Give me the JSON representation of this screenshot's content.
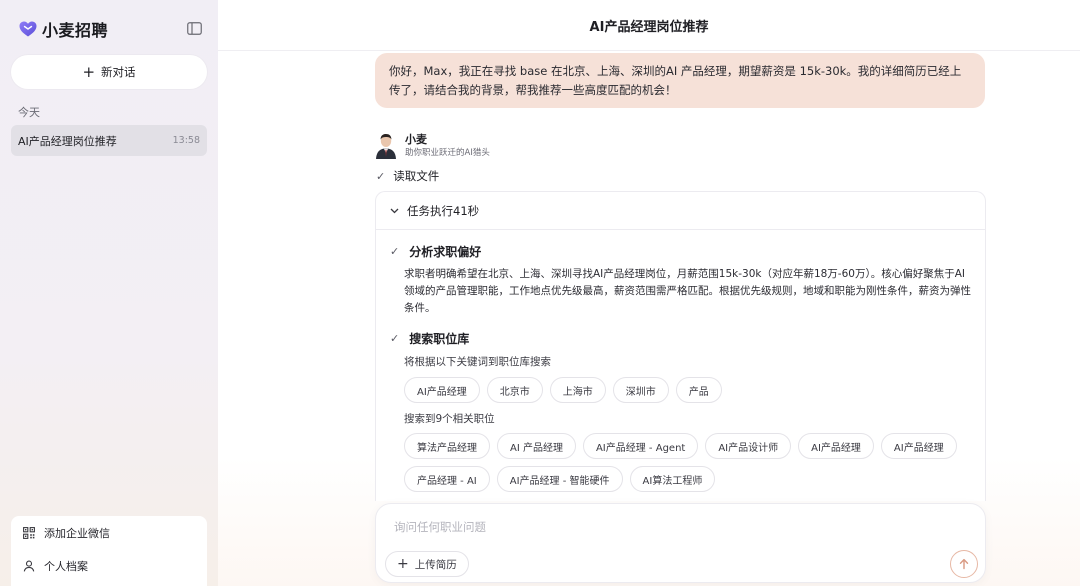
{
  "sidebar": {
    "brand_name": "小麦招聘",
    "new_chat_label": "新对话",
    "section_today": "今天",
    "history": [
      {
        "title": "AI产品经理岗位推荐",
        "time": "13:58"
      }
    ],
    "bottom_links": [
      {
        "label": "添加企业微信",
        "icon": "qr-code-icon"
      },
      {
        "label": "个人档案",
        "icon": "user-icon"
      }
    ]
  },
  "header": {
    "title": "AI产品经理岗位推荐"
  },
  "chat": {
    "user_message": "你好，Max，我正在寻找 base 在北京、上海、深圳的AI 产品经理，期望薪资是 15k-30k。我的详细简历已经上传了，请结合我的背景，帮我推荐一些高度匹配的机会！",
    "agent": {
      "name": "小麦",
      "subtitle": "助你职业跃迁的AI猎头"
    },
    "step_read_file": "读取文件",
    "task": {
      "header": "任务执行41秒",
      "section1": {
        "title": "分析求职偏好",
        "body": "求职者明确希望在北京、上海、深圳寻找AI产品经理岗位，月薪范围15k-30k（对应年薪18万-60万）。核心偏好聚焦于AI领域的产品管理职能，工作地点优先级最高，薪资范围需严格匹配。根据优先级规则，地域和职能为刚性条件，薪资为弹性条件。"
      },
      "section2": {
        "title": "搜索职位库",
        "keywords_note": "将根据以下关键词到职位库搜索",
        "keywords": [
          "AI产品经理",
          "北京市",
          "上海市",
          "深圳市",
          "产品"
        ],
        "results_note": "搜索到9个相关职位",
        "results_row1": [
          "算法产品经理",
          "AI 产品经理",
          "AI产品经理 - Agent",
          "AI产品设计师",
          "AI产品经理",
          "AI产品经理"
        ],
        "results_row2": [
          "产品经理 - AI",
          "AI产品经理 - 智能硬件",
          "AI算法工程师"
        ]
      }
    }
  },
  "composer": {
    "placeholder": "询问任何职业问题",
    "upload_label": "上传简历"
  },
  "colors": {
    "user_bubble": "#f6e1d8",
    "accent": "#e7b8a5",
    "brand": "#7b6cf0"
  }
}
